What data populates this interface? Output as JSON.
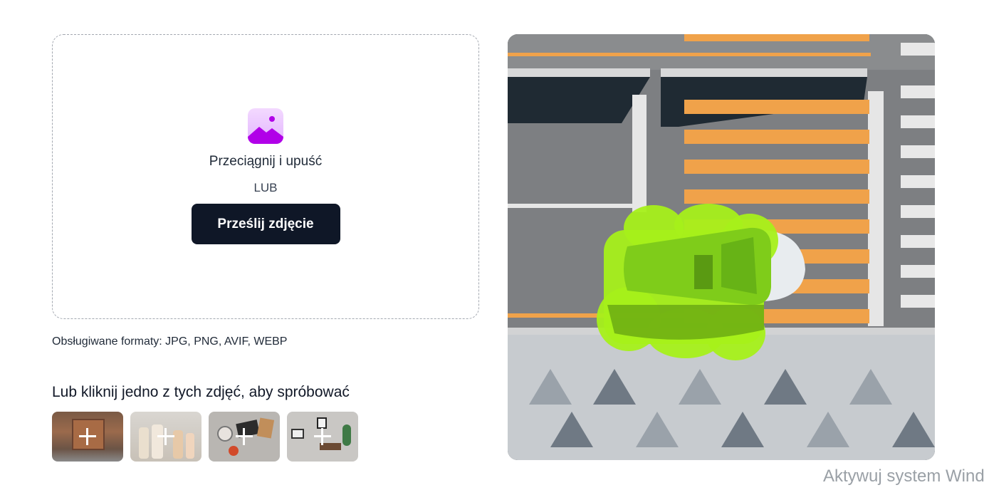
{
  "upload": {
    "icon": "image-icon",
    "drag_text": "Przeciągnij i upuść",
    "or_text": "LUB",
    "button_label": "Prześlij zdjęcie",
    "accent_color": "#0f1727"
  },
  "formats_text": "Obsługiwane formaty: JPG, PNG, AVIF, WEBP",
  "samples": {
    "heading": "Lub kliknij jedno z tych zdjęć, aby spróbować",
    "items": [
      {
        "icon": "plus-icon"
      },
      {
        "icon": "plus-icon"
      },
      {
        "icon": "plus-icon"
      },
      {
        "icon": "plus-icon"
      }
    ]
  },
  "result": {
    "highlight_color": "#a6f01a"
  },
  "watermark": {
    "title": "Aktywuj system Wind"
  }
}
